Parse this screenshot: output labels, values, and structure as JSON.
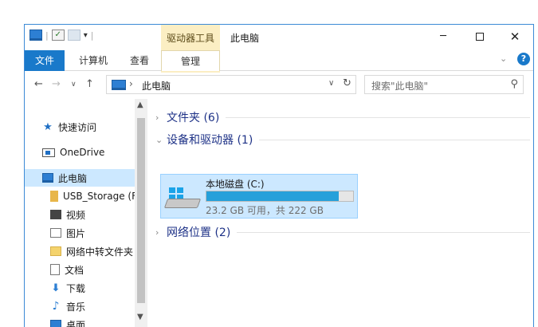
{
  "titlebar": {
    "context_tab": "驱动器工具",
    "title": "此电脑",
    "min": "─",
    "close": "✕"
  },
  "ribbon": {
    "file": "文件",
    "computer": "计算机",
    "view": "查看",
    "manage": "管理",
    "help": "?"
  },
  "address": {
    "path": "此电脑",
    "search_placeholder": "搜索\"此电脑\""
  },
  "nav": {
    "items": [
      {
        "label": "快速访问",
        "icon": "star-icon"
      },
      {
        "label": "OneDrive",
        "icon": "onedrive-icon"
      },
      {
        "label": "此电脑",
        "icon": "computer-icon"
      },
      {
        "label": "USB_Storage (F",
        "icon": "usb-drive-icon"
      },
      {
        "label": "视频",
        "icon": "video-icon"
      },
      {
        "label": "图片",
        "icon": "pictures-icon"
      },
      {
        "label": "网络中转文件夹",
        "icon": "folder-icon"
      },
      {
        "label": "文档",
        "icon": "documents-icon"
      },
      {
        "label": "下载",
        "icon": "download-icon"
      },
      {
        "label": "音乐",
        "icon": "music-icon"
      },
      {
        "label": "桌面",
        "icon": "desktop-icon"
      }
    ]
  },
  "content": {
    "groups": [
      {
        "title": "文件夹 (6)"
      },
      {
        "title": "设备和驱动器 (1)"
      },
      {
        "title": "网络位置 (2)"
      }
    ],
    "drive": {
      "name": "本地磁盘 (C:)",
      "info": "23.2 GB 可用，共 222 GB",
      "used_fraction": 0.9
    }
  },
  "colors": {
    "accent": "#1979ca",
    "selection": "#cce8ff",
    "bar_fill": "#26a0da",
    "context_tab": "#fbeec3"
  }
}
